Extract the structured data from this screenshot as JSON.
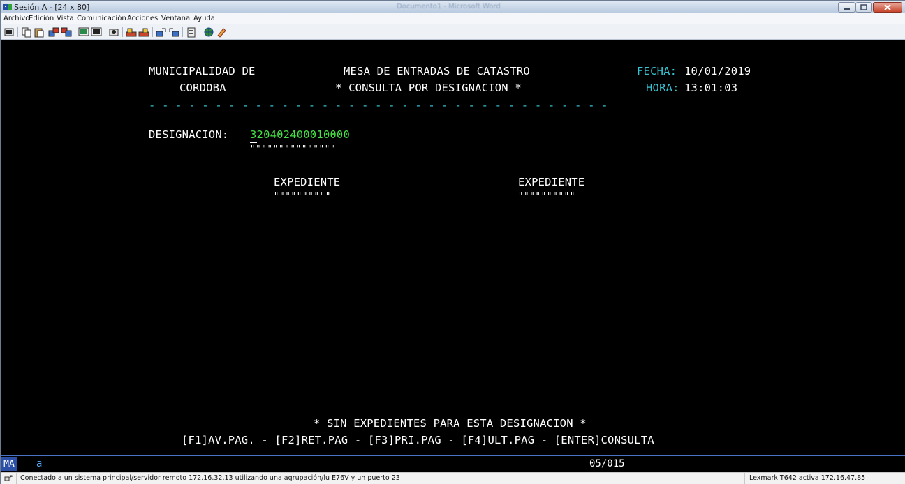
{
  "window": {
    "title": "Sesión A - [24 x 80]",
    "background_title": "Documento1 - Microsoft Word"
  },
  "menu": {
    "items": [
      "Archivo",
      "Edición",
      "Vista",
      "Comunicación",
      "Acciones",
      "Ventana",
      "Ayuda"
    ]
  },
  "toolbar": {
    "icons": [
      "print-screen-icon",
      "copy-icon",
      "paste-icon",
      "send-file-icon",
      "receive-file-icon",
      "display-setup-icon",
      "keyboard-setup-icon",
      "record-macro-icon",
      "play-macro-icon",
      "stop-macro-icon",
      "transfer-send-icon",
      "transfer-receive-icon",
      "customize-icon",
      "clipboard-icon",
      "globe-icon",
      "pencil-icon"
    ]
  },
  "screen": {
    "org_line1": "MUNICIPALIDAD DE",
    "org_line2": "CORDOBA",
    "title_line1": "MESA DE ENTRADAS DE CATASTRO",
    "title_line2": "* CONSULTA POR DESIGNACION *",
    "fecha_label": "FECHA:",
    "fecha_value": "10/01/2019",
    "hora_label": "HORA:",
    "hora_value": "13:01:03",
    "separator": "- - - - - - - - - - - - - - - - - - - - - - - - - - - - - - - - - - -",
    "designacion_label": "DESIGNACION:",
    "designacion_value": "320402400010000",
    "designacion_underline": "\"\"\"\"\"\"\"\"\"\"\"\"\"\"\"",
    "expediente_col1": "EXPEDIENTE",
    "expediente_col2": "EXPEDIENTE",
    "expediente_underline": "\"\"\"\"\"\"\"\"\"\"",
    "message": "* SIN EXPEDIENTES PARA ESTA DESIGNACION *",
    "function_keys": "[F1]AV.PAG. - [F2]RET.PAG - [F3]PRI.PAG - [F4]ULT.PAG - [ENTER]CONSULTA"
  },
  "oia": {
    "mode": "MA",
    "session": "a",
    "cursor_position": "05/015"
  },
  "status": {
    "message": "Conectado a un sistema principal/servidor remoto 172.16.32.13 utilizando una agrupación/lu E76V y un puerto 23",
    "printer": "Lexmark T642 activa 172.16.47.85"
  },
  "colors": {
    "terminal_bg": "#000000",
    "terminal_text": "#ffffff",
    "field_label": "#37c3d3",
    "input_value": "#45e045",
    "oia_mode_bg": "#2c50a8"
  }
}
